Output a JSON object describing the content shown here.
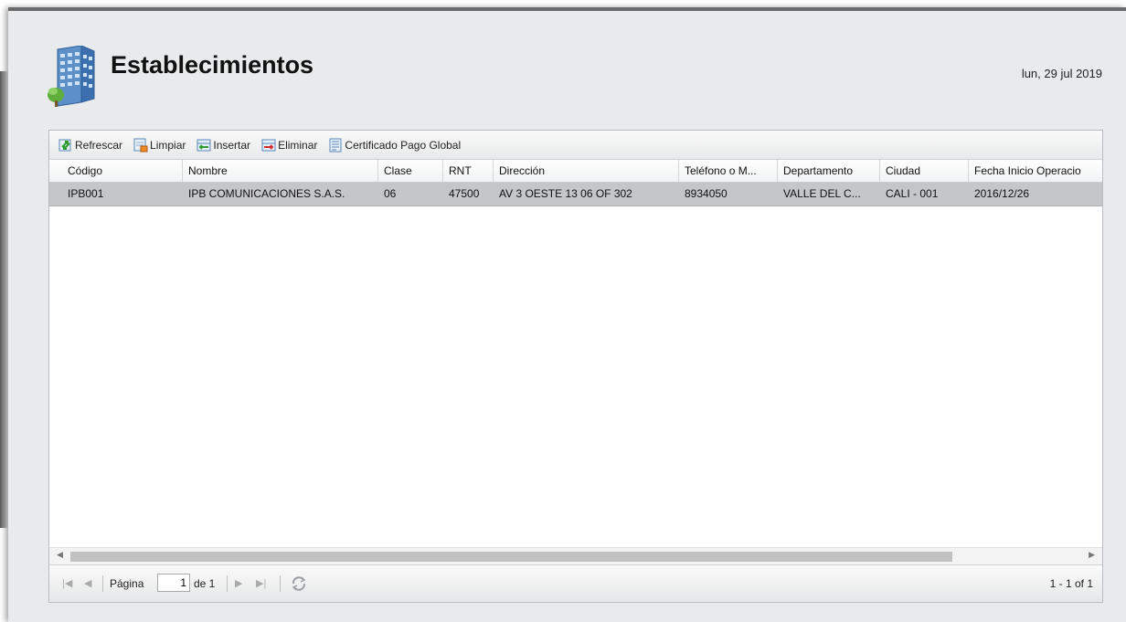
{
  "header": {
    "title": "Establecimientos",
    "date": "lun, 29 jul 2019",
    "icon": "building-icon"
  },
  "toolbar": {
    "refresh_label": "Refrescar",
    "clear_label": "Limpiar",
    "insert_label": "Insertar",
    "delete_label": "Eliminar",
    "certificate_label": "Certificado Pago Global"
  },
  "columns": [
    "Código",
    "Nombre",
    "Clase",
    "RNT",
    "Dirección",
    "Teléfono o M...",
    "Departamento",
    "Ciudad",
    "Fecha Inicio Operacio"
  ],
  "rows": [
    {
      "codigo": "IPB001",
      "nombre": "IPB COMUNICACIONES S.A.S.",
      "clase": "06",
      "rnt": "47500",
      "direccion": "AV 3 OESTE 13 06 OF 302",
      "telefono": "8934050",
      "departamento": "VALLE DEL C...",
      "ciudad": "CALI - 001",
      "fecha_inicio": "2016/12/26"
    }
  ],
  "pager": {
    "page_label": "Página",
    "page_value": "1",
    "of_label": "de 1",
    "display_info": "1 - 1 of 1"
  },
  "colors": {
    "selected_row": "#c5c6c8",
    "window_bg": "#e9eaeb"
  }
}
